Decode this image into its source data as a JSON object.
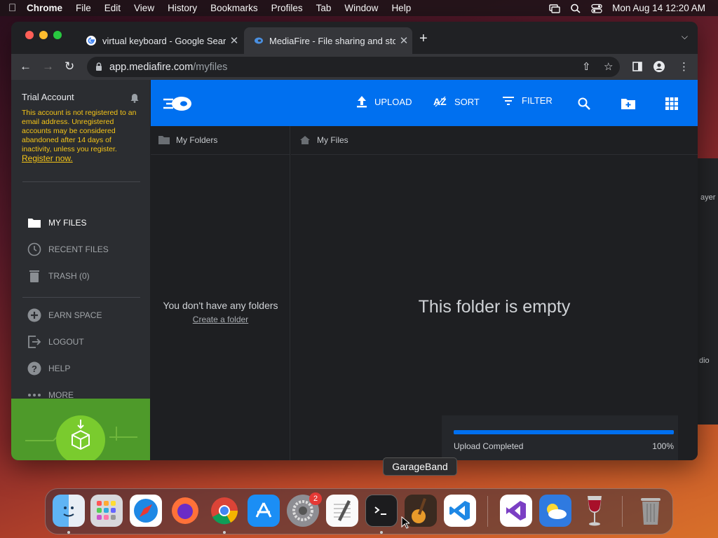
{
  "menubar": {
    "app": "Chrome",
    "items": [
      "File",
      "Edit",
      "View",
      "History",
      "Bookmarks",
      "Profiles",
      "Tab",
      "Window",
      "Help"
    ],
    "clock": "Mon Aug 14  12:20 AM"
  },
  "browser": {
    "tabs": [
      {
        "title": "virtual keyboard - Google Search"
      },
      {
        "title": "MediaFire - File sharing and storage"
      }
    ],
    "url_host": "app.mediafire.com",
    "url_path": "/myfiles"
  },
  "sidebar": {
    "account": "Trial Account",
    "notice": "This account is not registered to an email address. Unregistered accounts may be considered abandoned after 14 days of inactivity, unless you register.",
    "register_link": "Register now.",
    "items": [
      {
        "label": "MY FILES"
      },
      {
        "label": "RECENT FILES"
      },
      {
        "label": "TRASH (0)"
      },
      {
        "label": "EARN SPACE"
      },
      {
        "label": "LOGOUT"
      },
      {
        "label": "HELP"
      },
      {
        "label": "MORE"
      }
    ]
  },
  "header": {
    "upload": "UPLOAD",
    "sort": "SORT",
    "filter": "FILTER"
  },
  "folders": {
    "heading": "My Folders",
    "empty": "You don't have any folders",
    "create": "Create a folder"
  },
  "files": {
    "heading": "My Files",
    "empty": "This folder is empty"
  },
  "upload_status": {
    "text": "Upload Completed",
    "percent_label": "100%",
    "progress": 1.0
  },
  "background_app": {
    "snippet_top": "ayer",
    "snippet_bottom": "dio"
  },
  "dock": {
    "tooltip": "GarageBand",
    "settings_badge": "2",
    "apps": [
      "finder-icon",
      "launchpad-icon",
      "safari-icon",
      "firefox-icon",
      "chrome-icon",
      "app-store-icon",
      "system-settings-icon",
      "textedit-icon",
      "terminal-icon",
      "garageband-icon",
      "vscode-icon",
      "visual-studio-icon",
      "weather-icon",
      "wine-icon",
      "trash-icon"
    ]
  }
}
